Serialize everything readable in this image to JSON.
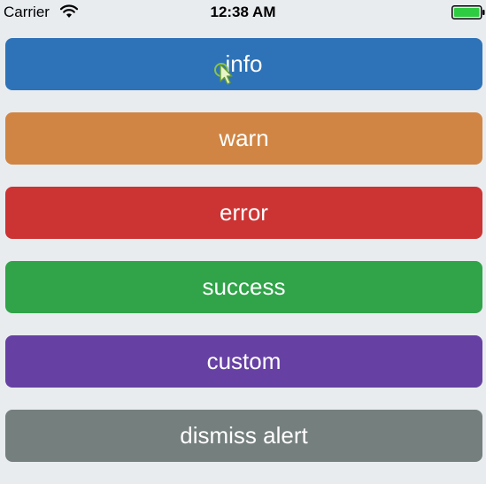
{
  "status_bar": {
    "carrier": "Carrier",
    "time": "12:38 AM",
    "wifi_icon": "wifi-icon",
    "battery_icon": "battery-icon",
    "battery_color": "#2ecc40"
  },
  "buttons": [
    {
      "label": "info",
      "color": "#2e73b8"
    },
    {
      "label": "warn",
      "color": "#d08544"
    },
    {
      "label": "error",
      "color": "#cc3333"
    },
    {
      "label": "success",
      "color": "#31a349"
    },
    {
      "label": "custom",
      "color": "#6641a3"
    },
    {
      "label": "dismiss alert",
      "color": "#757f7e"
    }
  ],
  "pointer_icon": "touch-pointer-icon"
}
